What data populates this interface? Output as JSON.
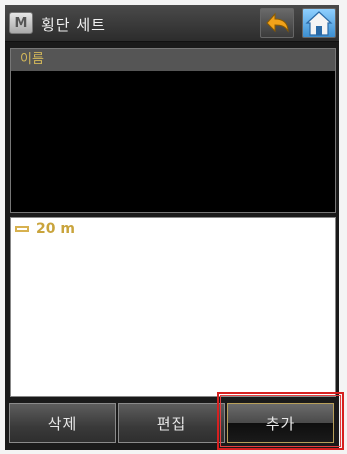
{
  "titlebar": {
    "menu_label": "M",
    "title": "횡단 세트",
    "back_icon": "back-arrow-icon",
    "home_icon": "home-icon"
  },
  "list": {
    "header": "이름",
    "items": []
  },
  "detail": {
    "entry_label": "20 m",
    "entry_icon": "section-width-icon"
  },
  "buttons": {
    "delete": "삭제",
    "edit": "편집",
    "add": "추가"
  },
  "colors": {
    "accent_text": "#c9a43c",
    "highlight": "#d62020"
  }
}
